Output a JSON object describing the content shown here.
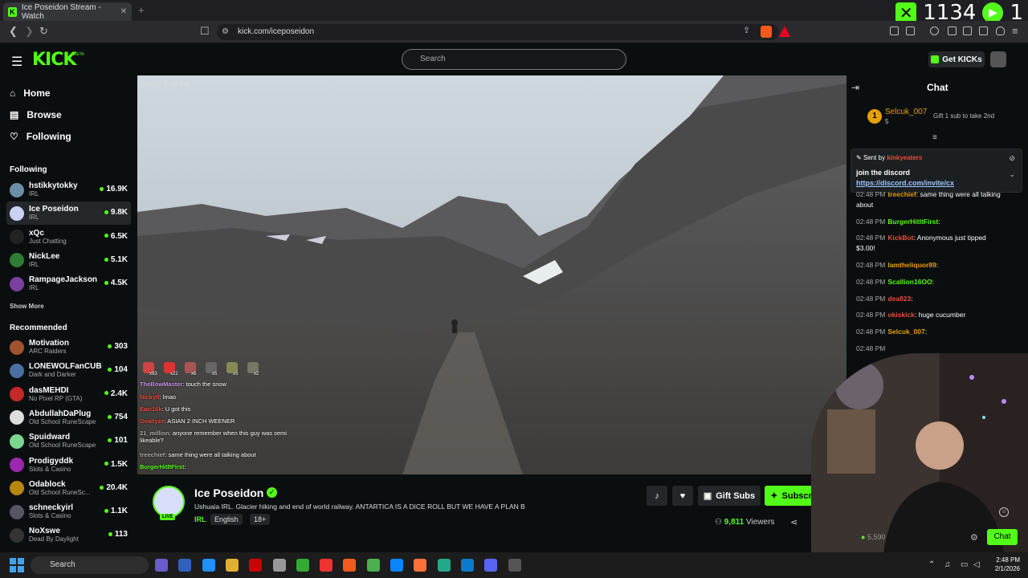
{
  "browser": {
    "tab_title": "Ice Poseidon Stream - Watch",
    "url": "kick.com/iceposeidon",
    "counter_value": "1134",
    "counter_suffix": "1"
  },
  "header": {
    "logo": "KICK",
    "beta": "BETA",
    "search_placeholder": "Search",
    "get_kicks": "Get KICKs"
  },
  "nav": [
    {
      "label": "Home",
      "icon": "home-icon"
    },
    {
      "label": "Browse",
      "icon": "browse-icon"
    },
    {
      "label": "Following",
      "icon": "heart-icon"
    }
  ],
  "following_heading": "Following",
  "following": [
    {
      "name": "hstikkytokky",
      "category": "IRL",
      "viewers": "16.9K",
      "color": "#6b8fa8"
    },
    {
      "name": "Ice Poseidon",
      "category": "IRL",
      "viewers": "9.8K",
      "color": "#c9d1f5"
    },
    {
      "name": "xQc",
      "category": "Just Chatting",
      "viewers": "6.5K",
      "color": "#222"
    },
    {
      "name": "NickLee",
      "category": "IRL",
      "viewers": "5.1K",
      "color": "#2e7d32"
    },
    {
      "name": "RampageJackson",
      "category": "IRL",
      "viewers": "4.5K",
      "color": "#7b3fa0"
    }
  ],
  "show_more": "Show More",
  "recommended_heading": "Recommended",
  "recommended": [
    {
      "name": "Motivation",
      "category": "ARC Raiders",
      "viewers": "303",
      "color": "#a0522d"
    },
    {
      "name": "LONEWOLFanCUB",
      "category": "Dark and Darker",
      "viewers": "104",
      "color": "#4a6fa5"
    },
    {
      "name": "dasMEHDI",
      "category": "No Pixel RP (GTA)",
      "viewers": "2.4K",
      "color": "#c62828"
    },
    {
      "name": "AbdullahDaPlug",
      "category": "Old School RuneScape",
      "viewers": "754",
      "color": "#ddd"
    },
    {
      "name": "Spuidward",
      "category": "Old School RuneScape",
      "viewers": "101",
      "color": "#7cd68e"
    },
    {
      "name": "Prodigyddk",
      "category": "Slots & Casino",
      "viewers": "1.5K",
      "color": "#9c27b0"
    },
    {
      "name": "Odablock",
      "category": "Old School RuneSc...",
      "viewers": "20.4K",
      "color": "#b8860b"
    },
    {
      "name": "schneckyirl",
      "category": "Slots & Casino",
      "viewers": "1.1K",
      "color": "#556"
    },
    {
      "name": "NoXswe",
      "category": "Dead By Daylight",
      "viewers": "113",
      "color": "#333"
    }
  ],
  "video": {
    "timestamp": "Feb 1, 7:48 PM",
    "overlay_counts": [
      "x93",
      "x22",
      "x6",
      "x5",
      "x3",
      "x2"
    ],
    "overlay_chat": [
      {
        "user": "TheBowMaster",
        "text": "touch the snow",
        "color": "#c792ea"
      },
      {
        "user": "Nickytl",
        "text": "lmao",
        "color": "#e74c3c"
      },
      {
        "user": "Eazi16k",
        "text": "U got this",
        "color": "#e74c3c"
      },
      {
        "user": "Geallyze",
        "text": "ASIAN 2 INCH WEENER",
        "color": "#e74c3c"
      },
      {
        "user": "21_million",
        "text": "anyone remember when this guy was semi likeable?",
        "color": "#aaa"
      },
      {
        "user": "treechief",
        "text": "same thing were all talking about",
        "color": "#aaa"
      },
      {
        "user": "BurgerHitltFirst",
        "text": "",
        "color": "#53fc18"
      }
    ]
  },
  "stream": {
    "name": "Ice Poseidon",
    "live": "LIVE",
    "title": "Ushuaia IRL. Glacier hiking and end of world railway. ANTARTICA IS A DICE ROLL BUT WE HAVE A PLAN B",
    "category": "IRL",
    "tags": [
      "English",
      "18+"
    ],
    "gift_subs": "Gift Subs",
    "subscribe": "Subscribe",
    "viewers": "9,811",
    "viewers_label": "Viewers"
  },
  "chat": {
    "title": "Chat",
    "top_gifter": {
      "rank": "1",
      "name": "Selcuk_007",
      "count": "5",
      "cta": "Gift 1 sub to take 2nd"
    },
    "pinned": {
      "sent_by": "Sent by",
      "user": "kinkyeaters",
      "text": "join the discord",
      "link": "https://discord.com/invite/cx"
    },
    "messages": [
      {
        "time": "02:48 PM",
        "user": "treechief",
        "text": "same thing were all talking about",
        "color": "#e5a000"
      },
      {
        "time": "02:48 PM",
        "user": "BurgerHitltFirst",
        "text": "",
        "color": "#53fc18"
      },
      {
        "time": "02:48 PM",
        "user": "KickBot",
        "text": "Anonymous just tipped $3.00!",
        "color": "#e74c3c"
      },
      {
        "time": "02:48 PM",
        "user": "Iamtheliquor89",
        "text": "",
        "color": "#e5a000"
      },
      {
        "time": "02:48 PM",
        "user": "Scallion16OO",
        "text": "",
        "color": "#53fc18"
      },
      {
        "time": "02:48 PM",
        "user": "dea823",
        "text": "",
        "color": "#e74c3c"
      },
      {
        "time": "02:48 PM",
        "user": "okiskick",
        "text": "huge cucumber",
        "color": "#e74c3c"
      },
      {
        "time": "02:48 PM",
        "user": "Selcuk_007",
        "text": "",
        "color": "#e5a000"
      },
      {
        "time": "02:48 PM",
        "user": "",
        "text": "",
        "color": "#888"
      }
    ],
    "balance": "5,590",
    "send_label": "Chat"
  },
  "taskbar": {
    "search": "Search",
    "time": "2:48 PM",
    "date": "2/1/2026"
  }
}
